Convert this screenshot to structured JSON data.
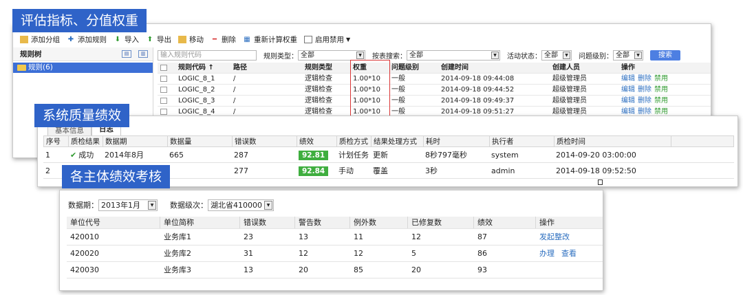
{
  "callouts": [
    "评估指标、分值权重",
    "系统质量绩效",
    "各主体绩效考核"
  ],
  "panel1": {
    "toolbar": [
      "添加分组",
      "添加规则",
      "导入",
      "导出",
      "移动",
      "删除",
      "重新计算权重",
      "启用禁用"
    ],
    "tree_title": "规则树",
    "tree_node": "规则(6)",
    "code_placeholder": "输入规则代码",
    "filters": {
      "rule_type_label": "规则类型：",
      "rule_type_value": "全部",
      "table_search_label": "按表搜索：",
      "table_search_value": "全部",
      "active_label": "活动状态：",
      "active_value": "全部",
      "level_label": "问题级别：",
      "level_value": "全部",
      "search_button": "搜索"
    },
    "headers": [
      "规则代码 ↑",
      "路径",
      "规则类型",
      "权重",
      "问题级别",
      "创建时间",
      "创建人员",
      "操作"
    ],
    "rows": [
      {
        "code": "LOGIC_8_1",
        "path": "/",
        "type": "逻辑检查",
        "weight": "1.00*10",
        "level": "一般",
        "time": "2014-09-18 09:44:08",
        "creator": "超级管理员"
      },
      {
        "code": "LOGIC_8_2",
        "path": "/",
        "type": "逻辑检查",
        "weight": "1.00*10",
        "level": "一般",
        "time": "2014-09-18 09:44:52",
        "creator": "超级管理员"
      },
      {
        "code": "LOGIC_8_3",
        "path": "/",
        "type": "逻辑检查",
        "weight": "1.00*10",
        "level": "一般",
        "time": "2014-09-18 09:49:37",
        "creator": "超级管理员"
      },
      {
        "code": "LOGIC_8_4",
        "path": "/",
        "type": "逻辑检查",
        "weight": "1.00*10",
        "level": "一般",
        "time": "2014-09-18 09:51:27",
        "creator": "超级管理员"
      }
    ],
    "actions": [
      "编辑",
      "删除",
      "禁用"
    ]
  },
  "panel2": {
    "tabs": [
      "基本信息",
      "日志"
    ],
    "headers": [
      "序号",
      "质检结果",
      "数据期",
      "数据量",
      "错误数",
      "绩效",
      "质检方式",
      "结果处理方式",
      "耗时",
      "执行者",
      "质检时间"
    ],
    "rows": [
      {
        "no": "1",
        "result": "成功",
        "period": "2014年8月",
        "count": "665",
        "errors": "287",
        "score": "92.81",
        "method": "计划任务",
        "handling": "更新",
        "duration": "8秒797毫秒",
        "executor": "system",
        "time": "2014-09-20 03:00:00"
      },
      {
        "no": "2",
        "result": "",
        "period": "",
        "count": "",
        "errors": "277",
        "score": "92.84",
        "method": "手动",
        "handling": "覆盖",
        "duration": "3秒",
        "executor": "admin",
        "time": "2014-09-18 09:52:50"
      }
    ]
  },
  "panel3": {
    "period_label": "数据期：",
    "period_value": "2013年1月",
    "level_label": "数据级次：",
    "level_value": "湖北省410000",
    "headers": [
      "单位代号",
      "单位简称",
      "错误数",
      "警告数",
      "例外数",
      "已修复数",
      "绩效",
      "操作"
    ],
    "rows": [
      {
        "code": "420010",
        "name": "业务库1",
        "errors": "23",
        "warnings": "13",
        "exceptions": "11",
        "fixed": "12",
        "score": "87",
        "actions": [
          "发起整改"
        ]
      },
      {
        "code": "420020",
        "name": "业务库2",
        "errors": "31",
        "warnings": "12",
        "exceptions": "12",
        "fixed": "5",
        "score": "86",
        "actions": [
          "办理",
          "查看"
        ]
      },
      {
        "code": "420030",
        "name": "业务库3",
        "errors": "13",
        "warnings": "20",
        "exceptions": "85",
        "fixed": "20",
        "score": "93",
        "actions": []
      }
    ]
  },
  "colors": {
    "callout": "#2f63c8",
    "score_badge": "#3fae3f",
    "highlight": "#d93535",
    "link": "#2d6fc0"
  }
}
